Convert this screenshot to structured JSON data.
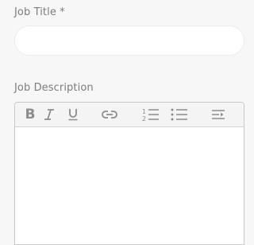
{
  "form": {
    "job_title_label": "Job Title *",
    "job_title_value": "",
    "job_description_label": "Job Description",
    "job_description_value": ""
  },
  "toolbar": {
    "bold_label": "B",
    "icons": [
      "bold-icon",
      "italic-icon",
      "underline-icon",
      "link-icon",
      "ordered-list-icon",
      "unordered-list-icon",
      "indent-icon"
    ]
  },
  "colors": {
    "page_background": "#f7f7f7",
    "label_text": "#7d7d7d",
    "icon": "#8c8c8c",
    "editor_border": "#c9c9c9",
    "toolbar_background": "#f4f4f4"
  }
}
